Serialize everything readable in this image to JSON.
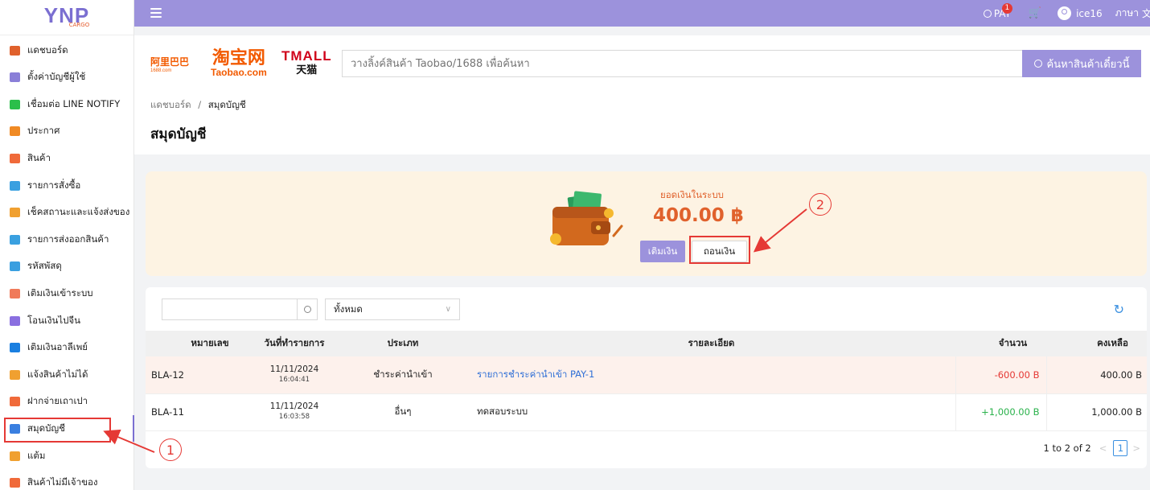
{
  "logo": {
    "main": "YNP",
    "sub": "CARGO"
  },
  "sidebar": {
    "items": [
      {
        "label": "แดชบอร์ด",
        "icon": "dashboard-icon",
        "color": "#e0612c"
      },
      {
        "label": "ตั้งค่าบัญชีผู้ใช้",
        "icon": "user-settings-icon",
        "color": "#8a7fd8"
      },
      {
        "label": "เชื่อมต่อ LINE NOTIFY",
        "icon": "line-icon",
        "color": "#2bbf4a"
      },
      {
        "label": "ประกาศ",
        "icon": "megaphone-icon",
        "color": "#f08a24"
      },
      {
        "label": "สินค้า",
        "icon": "product-icon",
        "color": "#f06a3a"
      },
      {
        "label": "รายการสั่งซื้อ",
        "icon": "cart-icon",
        "color": "#3aa0e0"
      },
      {
        "label": "เช็คสถานะและแจ้งส่งของ",
        "icon": "truck-icon",
        "color": "#f0a030"
      },
      {
        "label": "รายการส่งออกสินค้า",
        "icon": "export-icon",
        "color": "#3aa0e0"
      },
      {
        "label": "รหัสพัสดุ",
        "icon": "box-icon",
        "color": "#3a9fe0"
      },
      {
        "label": "เติมเงินเข้าระบบ",
        "icon": "piggy-icon",
        "color": "#f07a5a"
      },
      {
        "label": "โอนเงินไปจีน",
        "icon": "yuan-icon",
        "color": "#8a6fe0"
      },
      {
        "label": "เติมเงินอาลีเพย์",
        "icon": "alipay-icon",
        "color": "#1a7fe0"
      },
      {
        "label": "แจ้งสินค้าไม่ได้",
        "icon": "report-icon",
        "color": "#f0a030"
      },
      {
        "label": "ฝากจ่ายเถาเปา",
        "icon": "taobao-icon",
        "color": "#f06a3a"
      },
      {
        "label": "สมุดบัญชี",
        "icon": "wallet-icon",
        "color": "#3a7fe0"
      },
      {
        "label": "แต้ม",
        "icon": "points-icon",
        "color": "#f0a030"
      },
      {
        "label": "สินค้าไม่มีเจ้าของ",
        "icon": "unclaimed-icon",
        "color": "#f06a3a"
      }
    ],
    "active": "สมุดบัญชี"
  },
  "topbar": {
    "pay_label": "PAY",
    "pay_badge": "1",
    "user": "ice16",
    "lang": "ภาษา"
  },
  "brands": {
    "alibaba": "阿里巴巴",
    "alibaba_sub": "1688.com",
    "taobao": "淘宝网",
    "taobao_sub": "Taobao.com",
    "tmall": "TMALL",
    "tmall_sub": "天猫"
  },
  "search": {
    "placeholder": "วางลิ้งค์สินค้า Taobao/1688 เพื่อค้นหา",
    "button": "ค้นหาสินค้าเดี๋ยวนี้"
  },
  "breadcrumb": {
    "home": "แดชบอร์ด",
    "sep": "/",
    "current": "สมุดบัญชี"
  },
  "page_title": "สมุดบัญชี",
  "wallet": {
    "label": "ยอดเงินในระบบ",
    "amount": "400.00 ฿",
    "topup": "เติมเงิน",
    "withdraw": "ถอนเงิน"
  },
  "filter": {
    "select_value": "ทั้งหมด"
  },
  "table": {
    "headers": [
      "หมายเลข",
      "วันที่ทำรายการ",
      "ประเภท",
      "รายละเอียด",
      "จำนวน",
      "คงเหลือ"
    ],
    "rows": [
      {
        "id": "BLA-12",
        "date": "11/11/2024",
        "time": "16:04:41",
        "type": "ชำระค่านำเข้า",
        "detail": "รายการชำระค่านำเข้า PAY-1",
        "amount": "-600.00 B",
        "balance": "400.00 B",
        "amount_color": "#e53935",
        "detail_color": "#2f6fd6"
      },
      {
        "id": "BLA-11",
        "date": "11/11/2024",
        "time": "16:03:58",
        "type": "อื่นๆ",
        "detail": "ทดสอบระบบ",
        "amount": "+1,000.00 B",
        "balance": "1,000.00 B",
        "amount_color": "#2bb24c",
        "detail_color": "#222"
      }
    ]
  },
  "pagination": {
    "summary": "1 to 2 of 2",
    "page": "1"
  },
  "annotations": {
    "one": "1",
    "two": "2",
    "color": "#e53935"
  }
}
